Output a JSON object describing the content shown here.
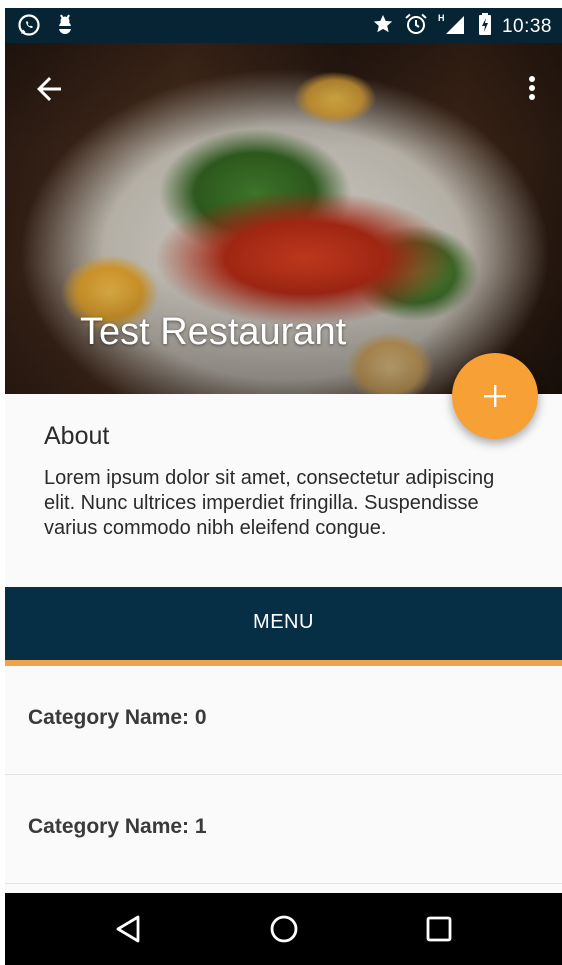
{
  "status_bar": {
    "left_icons": [
      "whatsapp-icon",
      "android-debug-icon"
    ],
    "right_icons": [
      "star-icon",
      "alarm-icon",
      "signal-h-icon",
      "battery-charging-icon"
    ],
    "time": "10:38"
  },
  "hero": {
    "title": "Test Restaurant",
    "back_icon": "arrow-back-icon",
    "more_icon": "more-vert-icon"
  },
  "fab": {
    "icon": "plus-icon",
    "color": "#f7a036"
  },
  "about": {
    "heading": "About",
    "body": "Lorem ipsum dolor sit amet, consectetur adipiscing elit. Nunc ultrices imperdiet fringilla. Suspendisse varius commodo nibh eleifend congue."
  },
  "tabs": {
    "menu_label": "MENU",
    "bar_color": "#062f45",
    "indicator_color": "#f1a24f"
  },
  "categories": [
    {
      "label": "Category Name: 0"
    },
    {
      "label": "Category Name: 1"
    }
  ],
  "nav_bar": {
    "buttons": [
      "back-triangle-icon",
      "home-circle-icon",
      "recents-square-icon"
    ]
  },
  "colors": {
    "status_bar": "#062433",
    "accent": "#f7a036"
  }
}
